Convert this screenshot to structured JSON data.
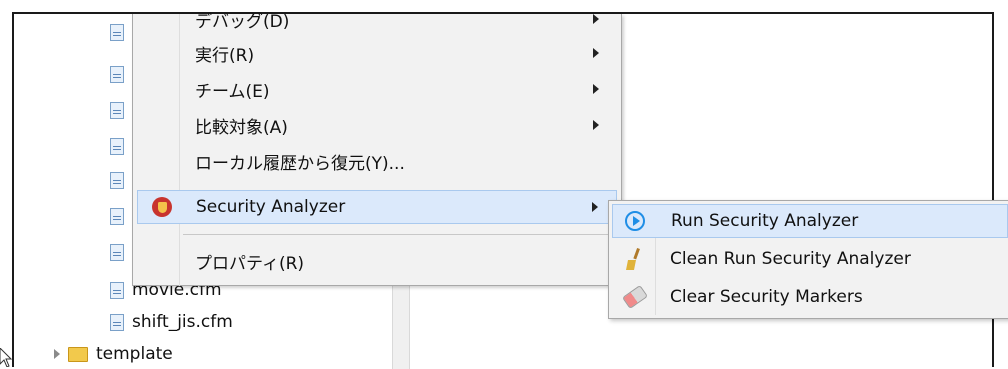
{
  "tree": {
    "items": [
      {
        "label": "movie.cfm",
        "type": "file"
      },
      {
        "label": "shift_jis.cfm",
        "type": "file"
      },
      {
        "label": "template",
        "type": "folder"
      }
    ]
  },
  "context_menu": {
    "items": [
      {
        "label": "デバッグ(D)",
        "has_submenu": true
      },
      {
        "label": "実行(R)",
        "has_submenu": true
      },
      {
        "label": "チーム(E)",
        "has_submenu": true
      },
      {
        "label": "比較対象(A)",
        "has_submenu": true
      },
      {
        "label": "ローカル履歴から復元(Y)...",
        "has_submenu": false
      },
      {
        "label": "Security Analyzer",
        "has_submenu": true,
        "icon": "security-analyzer-icon"
      },
      {
        "label": "プロパティ(R)",
        "has_submenu": false
      }
    ]
  },
  "submenu": {
    "items": [
      {
        "label": "Run Security Analyzer",
        "icon": "run-icon"
      },
      {
        "label": "Clean Run Security Analyzer",
        "icon": "broom-icon"
      },
      {
        "label": "Clear Security Markers",
        "icon": "eraser-icon"
      }
    ]
  },
  "colors": {
    "highlight": "#dbe9fb",
    "highlight_border": "#a9c9ee",
    "menu_bg": "#f2f2f2"
  }
}
